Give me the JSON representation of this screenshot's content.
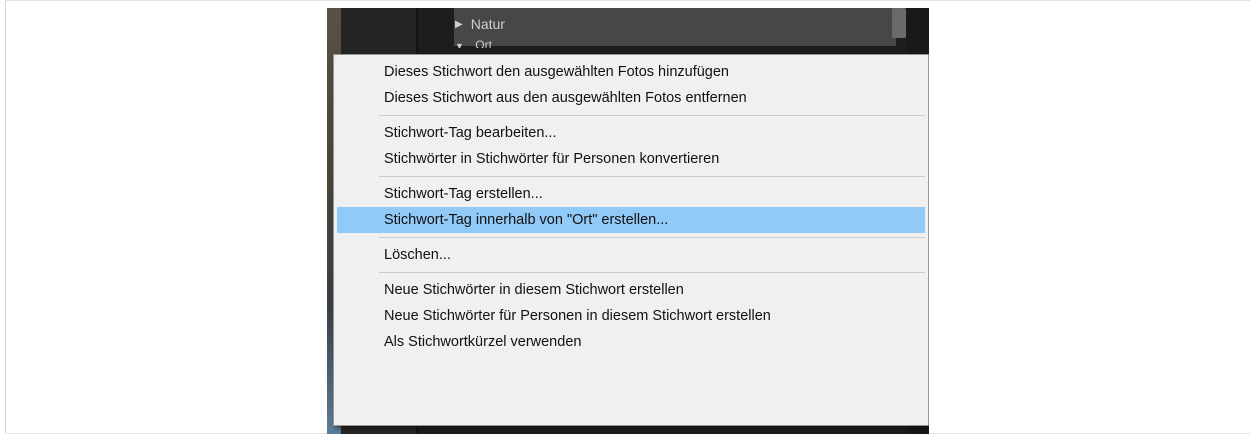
{
  "background_app": {
    "panel_row_label": "Natur",
    "panel_row_partial": "Ort"
  },
  "context_menu": {
    "groups": [
      {
        "items": [
          {
            "label": "Dieses Stichwort den ausgewählten Fotos hinzufügen",
            "highlighted": false
          },
          {
            "label": "Dieses Stichwort aus den ausgewählten Fotos entfernen",
            "highlighted": false
          }
        ]
      },
      {
        "items": [
          {
            "label": "Stichwort-Tag bearbeiten...",
            "highlighted": false
          },
          {
            "label": "Stichwörter in Stichwörter für Personen konvertieren",
            "highlighted": false
          }
        ]
      },
      {
        "items": [
          {
            "label": "Stichwort-Tag erstellen...",
            "highlighted": false
          },
          {
            "label": "Stichwort-Tag innerhalb von \"Ort\" erstellen...",
            "highlighted": true
          }
        ]
      },
      {
        "items": [
          {
            "label": "Löschen...",
            "highlighted": false
          }
        ]
      },
      {
        "items": [
          {
            "label": "Neue Stichwörter in diesem Stichwort erstellen",
            "highlighted": false
          },
          {
            "label": "Neue Stichwörter für Personen in diesem Stichwort erstellen",
            "highlighted": false
          },
          {
            "label": "Als Stichwortkürzel verwenden",
            "highlighted": false
          }
        ]
      }
    ]
  },
  "colors": {
    "highlight": "#91c9f7",
    "menu_background": "#f0f0f0",
    "dark_panel": "#1d1d1d"
  }
}
